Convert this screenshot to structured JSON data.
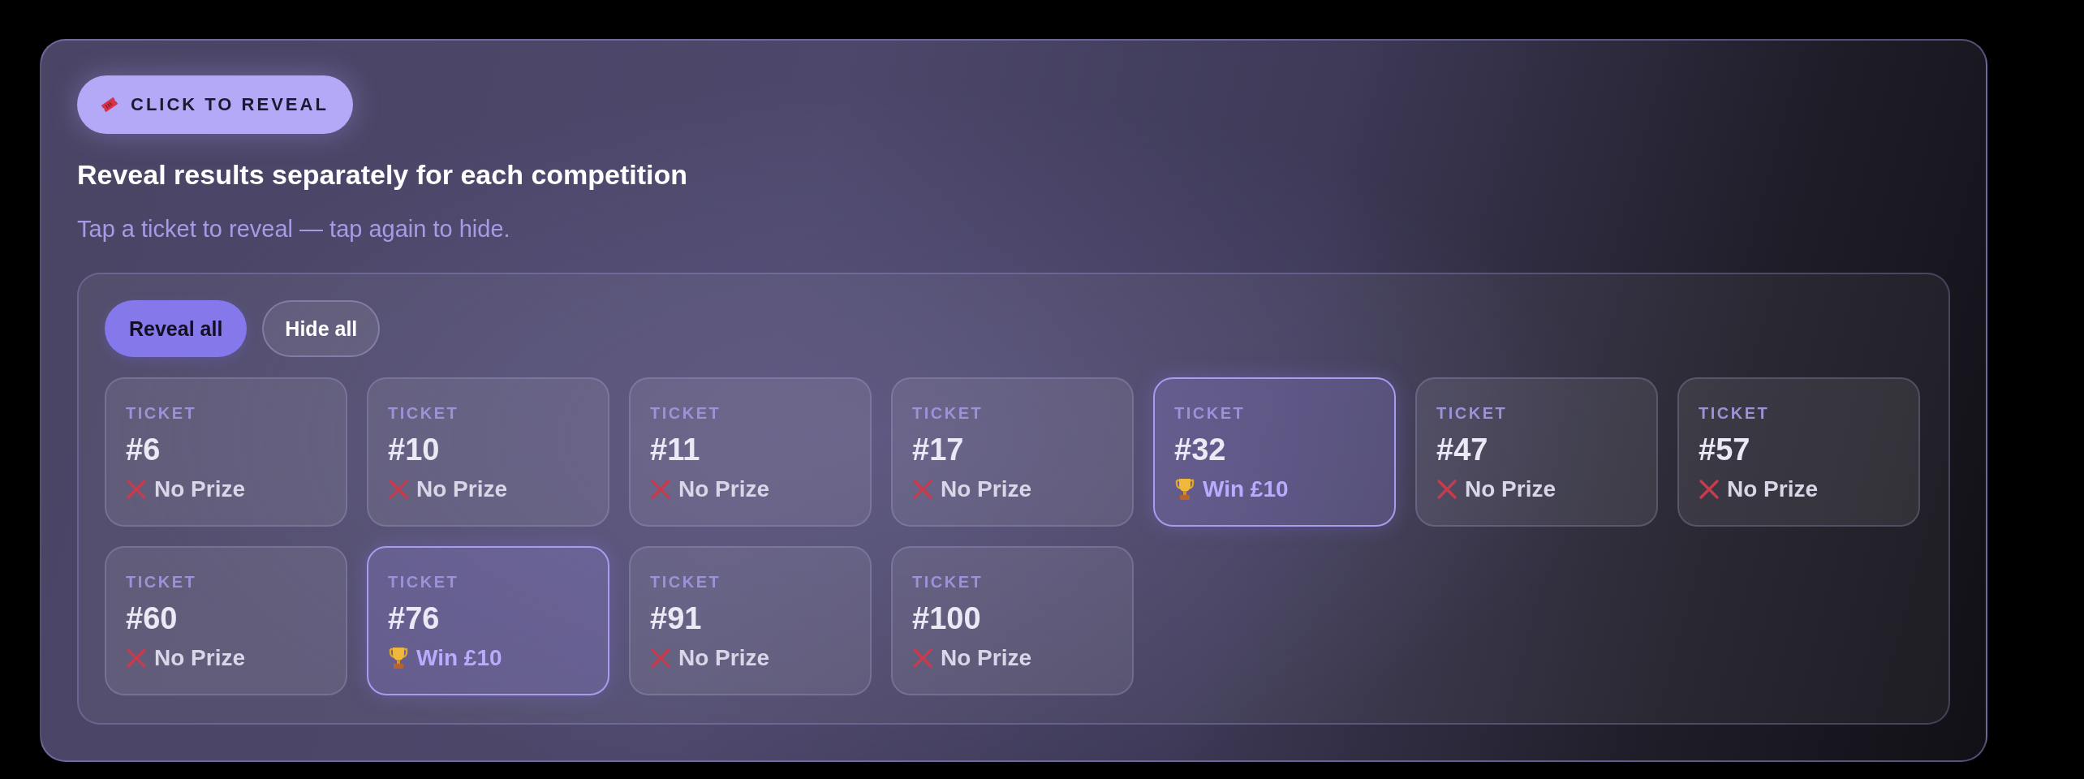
{
  "badge": {
    "label": "CLICK TO REVEAL"
  },
  "title": "Reveal results separately for each competition",
  "subtitle": "Tap a ticket to reveal — tap again to hide.",
  "actions": [
    {
      "label": "Reveal all",
      "kind": "primary"
    },
    {
      "label": "Hide all",
      "kind": "secondary"
    }
  ],
  "tickets": [
    {
      "label": "TICKET",
      "number": "#6",
      "result": "No Prize",
      "kind": "lose"
    },
    {
      "label": "TICKET",
      "number": "#10",
      "result": "No Prize",
      "kind": "lose"
    },
    {
      "label": "TICKET",
      "number": "#11",
      "result": "No Prize",
      "kind": "lose"
    },
    {
      "label": "TICKET",
      "number": "#17",
      "result": "No Prize",
      "kind": "lose"
    },
    {
      "label": "TICKET",
      "number": "#32",
      "result": "Win £10",
      "kind": "win"
    },
    {
      "label": "TICKET",
      "number": "#47",
      "result": "No Prize",
      "kind": "lose"
    },
    {
      "label": "TICKET",
      "number": "#57",
      "result": "No Prize",
      "kind": "lose"
    },
    {
      "label": "TICKET",
      "number": "#60",
      "result": "No Prize",
      "kind": "lose"
    },
    {
      "label": "TICKET",
      "number": "#76",
      "result": "Win £10",
      "kind": "win"
    },
    {
      "label": "TICKET",
      "number": "#91",
      "result": "No Prize",
      "kind": "lose"
    },
    {
      "label": "TICKET",
      "number": "#100",
      "result": "No Prize",
      "kind": "lose"
    }
  ]
}
